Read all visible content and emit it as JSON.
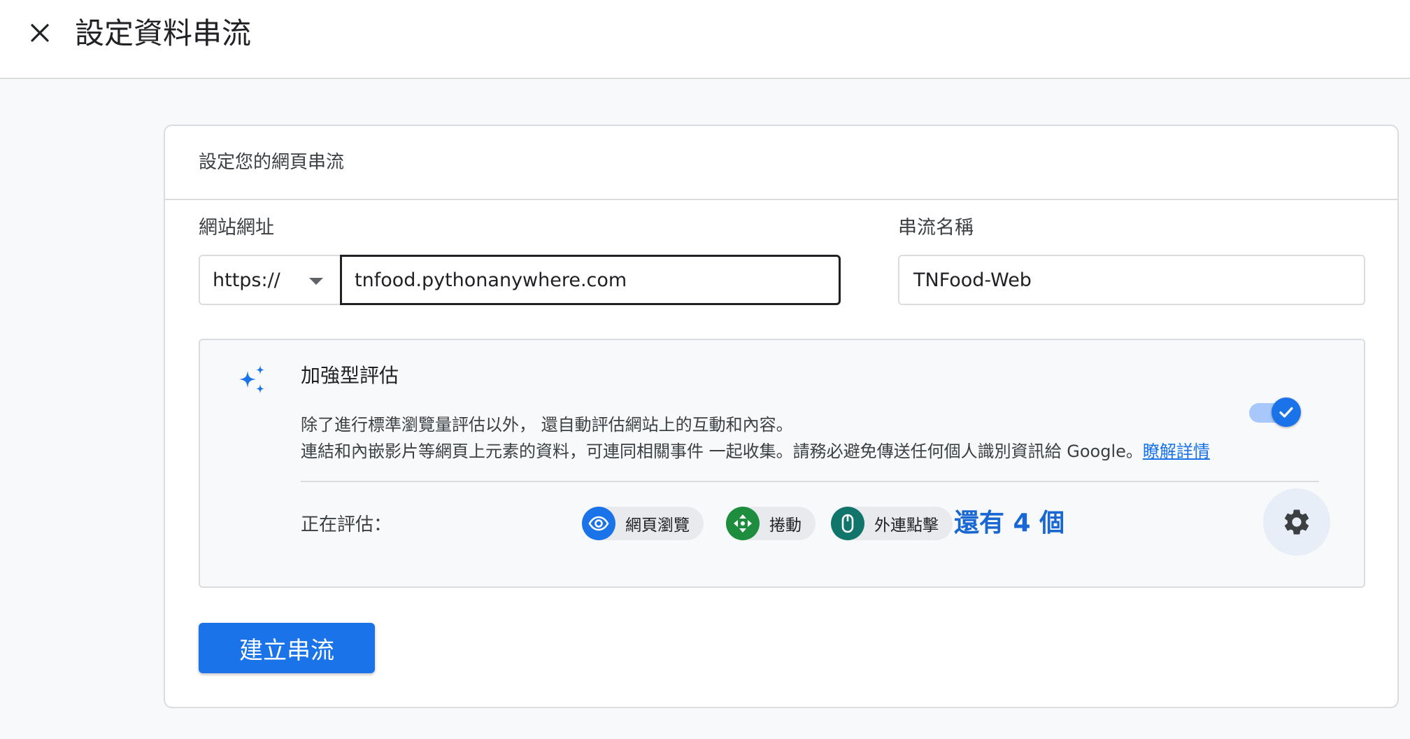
{
  "header": {
    "title": "設定資料串流",
    "close_icon": "close-icon"
  },
  "card": {
    "title": "設定您的網頁串流",
    "website_url_label": "網站網址",
    "protocol_value": "https://",
    "url_value": "tnfood.pythonanywhere.com",
    "stream_name_label": "串流名稱",
    "stream_name_value": "TNFood-Web"
  },
  "enhanced": {
    "icon": "sparkle-icon",
    "title": "加強型評估",
    "desc_line1": "除了進行標準瀏覽量評估以外， 還自動評估網站上的互動和內容。",
    "desc_line2": "連結和內嵌影片等網頁上元素的資料，可連同相關事件 一起收集。請務必避免傳送任何個人識別資訊給 Google。",
    "learn_more": "瞭解詳情",
    "toggle_on": true,
    "measuring_label": "正在評估：",
    "chips": [
      {
        "label": "網頁瀏覽",
        "icon": "eye-icon",
        "color": "#1a73e8"
      },
      {
        "label": "捲動",
        "icon": "scroll-arrows-icon",
        "color": "#1e8e3e"
      },
      {
        "label": "外連點擊",
        "icon": "mouse-icon",
        "color": "#12756b"
      }
    ],
    "more_link": "還有 4 個",
    "settings_icon": "gear-icon"
  },
  "actions": {
    "create_label": "建立串流"
  },
  "colors": {
    "accent": "#1a73e8",
    "border": "#dadce0",
    "background": "#f8f9fa"
  }
}
